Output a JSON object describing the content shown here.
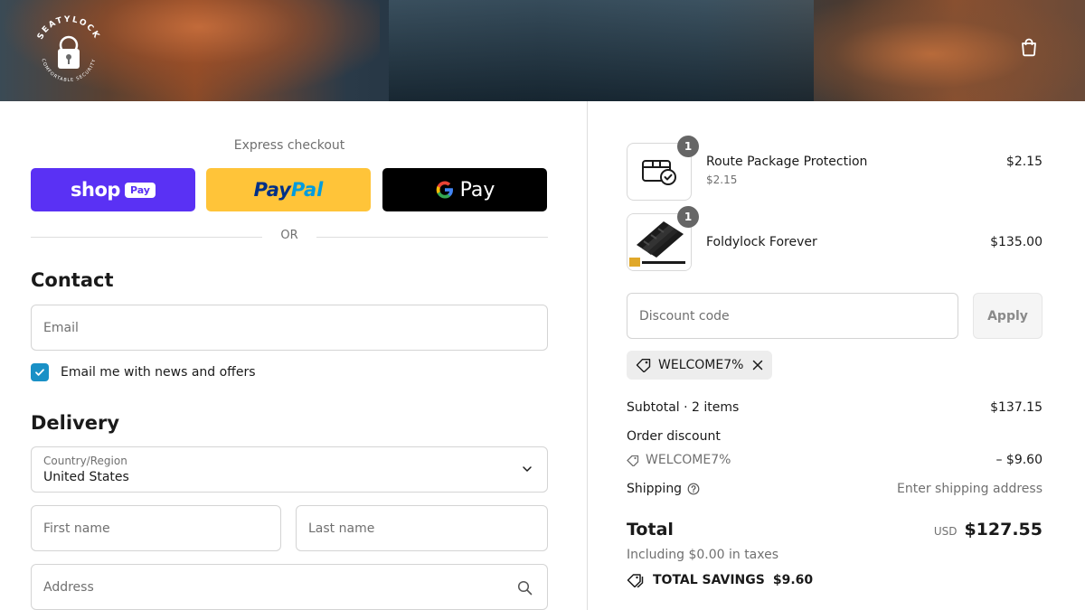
{
  "header": {
    "logo_text": "SEATYLOCK",
    "logo_subtext": "COMFORTABLE SECURITY",
    "bag_icon": "shopping-bag-icon"
  },
  "express": {
    "title": "Express checkout",
    "buttons": [
      {
        "name": "shop",
        "label": "shop",
        "badge": "Pay",
        "color": "#5a31f4"
      },
      {
        "name": "paypal",
        "label_dark": "Pay",
        "label_light": "Pal",
        "color": "#ffc439"
      },
      {
        "name": "gpay",
        "label": "Pay",
        "color": "#000000"
      }
    ],
    "or": "OR"
  },
  "contact": {
    "heading": "Contact",
    "email_placeholder": "Email",
    "newsletter_label": "Email me with news and offers",
    "newsletter_checked": true
  },
  "delivery": {
    "heading": "Delivery",
    "country_label": "Country/Region",
    "country_value": "United States",
    "first_name_placeholder": "First name",
    "last_name_placeholder": "Last name",
    "address_placeholder": "Address"
  },
  "summary": {
    "items": [
      {
        "name": "Route Package Protection",
        "sub": "$2.15",
        "price": "$2.15",
        "qty": "1",
        "icon": "package-check-icon"
      },
      {
        "name": "Foldylock Forever",
        "price": "$135.00",
        "qty": "1",
        "icon": "folding-lock-product"
      }
    ],
    "discount_placeholder": "Discount code",
    "apply_label": "Apply",
    "applied_code": "WELCOME7%",
    "subtotal_label": "Subtotal · 2 items",
    "subtotal_value": "$137.15",
    "order_discount_label": "Order discount",
    "order_discount_code": "WELCOME7%",
    "order_discount_value": "– $9.60",
    "shipping_label": "Shipping",
    "shipping_value": "Enter shipping address",
    "total_label": "Total",
    "currency": "USD",
    "total_value": "$127.55",
    "taxes_note": "Including $0.00 in taxes",
    "savings_label": "TOTAL SAVINGS",
    "savings_value": "$9.60"
  },
  "colors": {
    "accent": "#1990c6",
    "shop_pay": "#5a31f4",
    "paypal": "#ffc439",
    "gpay": "#000000"
  }
}
